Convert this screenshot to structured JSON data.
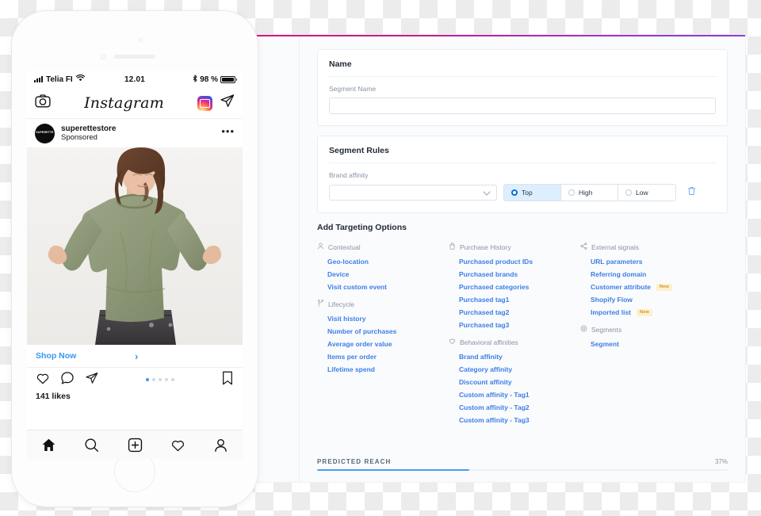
{
  "phone": {
    "status_bar": {
      "carrier": "Telia FI",
      "time": "12.01",
      "battery": "98 %",
      "signal_icon": "cellular-bars-icon",
      "wifi_icon": "wifi-icon",
      "bluetooth_icon": "bluetooth-icon",
      "battery_icon": "battery-icon",
      "battery_level": 98
    },
    "ig_header": {
      "camera_icon": "camera-icon",
      "logo": "Instagram",
      "igtv_icon": "igtv-icon",
      "direct_icon": "paper-plane-icon"
    },
    "post": {
      "avatar_text": "SUPERETTE",
      "username": "superettestore",
      "subtitle": "Sponsored",
      "more_icon": "more-options-icon",
      "image_alt": "woman-in-olive-green-long-sleeve-shirt",
      "cta_label": "Shop Now",
      "cta_chevron_icon": "chevron-right-icon",
      "like_icon": "heart-icon",
      "comment_icon": "comment-bubble-icon",
      "share_icon": "paper-plane-icon",
      "save_icon": "bookmark-icon",
      "carousel_dots": 5,
      "carousel_active_index": 0,
      "likes": "141 likes"
    },
    "tabbar": [
      {
        "icon": "home-icon",
        "name": "tab-home",
        "active": true
      },
      {
        "icon": "search-icon",
        "name": "tab-search",
        "active": false
      },
      {
        "icon": "add-post-icon",
        "name": "tab-add",
        "active": false
      },
      {
        "icon": "heart-icon",
        "name": "tab-activity",
        "active": false
      },
      {
        "icon": "profile-icon",
        "name": "tab-profile",
        "active": false
      }
    ]
  },
  "panel": {
    "accent_gradient_from": "#d6177f",
    "accent_gradient_to": "#8a3fd6",
    "name_card": {
      "title": "Name",
      "field_label": "Segment Name",
      "field_value": "",
      "field_placeholder": ""
    },
    "rules_card": {
      "title": "Segment Rules",
      "field_label": "Brand affinity",
      "select_value": "",
      "select_icon": "chevron-down-icon",
      "delete_icon": "trash-icon",
      "options": [
        {
          "label": "Top",
          "selected": true
        },
        {
          "label": "High",
          "selected": false
        },
        {
          "label": "Low",
          "selected": false
        }
      ]
    },
    "targeting": {
      "title": "Add Targeting Options",
      "columns": [
        {
          "groups": [
            {
              "heading": "Contextual",
              "icon": "person-icon",
              "items": [
                {
                  "label": "Geo-location"
                },
                {
                  "label": "Device"
                },
                {
                  "label": "Visit custom event"
                }
              ]
            },
            {
              "heading": "Lifecycle",
              "icon": "branch-icon",
              "items": [
                {
                  "label": "Visit history"
                },
                {
                  "label": "Number of purchases"
                },
                {
                  "label": "Average order value"
                },
                {
                  "label": "Items per order"
                },
                {
                  "label": "Lifetime spend"
                }
              ]
            }
          ]
        },
        {
          "groups": [
            {
              "heading": "Purchase History",
              "icon": "bag-icon",
              "items": [
                {
                  "label": "Purchased product IDs"
                },
                {
                  "label": "Purchased brands"
                },
                {
                  "label": "Purchased categories"
                },
                {
                  "label": "Purchased tag1"
                },
                {
                  "label": "Purchased tag2"
                },
                {
                  "label": "Purchased tag3"
                }
              ]
            },
            {
              "heading": "Behavioral affinities",
              "icon": "heart-icon",
              "items": [
                {
                  "label": "Brand affinity"
                },
                {
                  "label": "Category affinity"
                },
                {
                  "label": "Discount affinity"
                },
                {
                  "label": "Custom affinity - Tag1"
                },
                {
                  "label": "Custom affinity - Tag2"
                },
                {
                  "label": "Custom affinity - Tag3"
                }
              ]
            }
          ]
        },
        {
          "groups": [
            {
              "heading": "External signals",
              "icon": "share-nodes-icon",
              "items": [
                {
                  "label": "URL parameters"
                },
                {
                  "label": "Referring domain"
                },
                {
                  "label": "Customer attribute",
                  "badge": "New"
                },
                {
                  "label": "Shopify Flow"
                },
                {
                  "label": "Imported list",
                  "badge": "New"
                }
              ]
            },
            {
              "heading": "Segments",
              "icon": "target-icon",
              "items": [
                {
                  "label": "Segment"
                }
              ]
            }
          ]
        }
      ]
    },
    "reach": {
      "label": "PREDICTED REACH",
      "percent_label": "37%",
      "percent_value": 37,
      "bar_color": "#479df4"
    }
  }
}
